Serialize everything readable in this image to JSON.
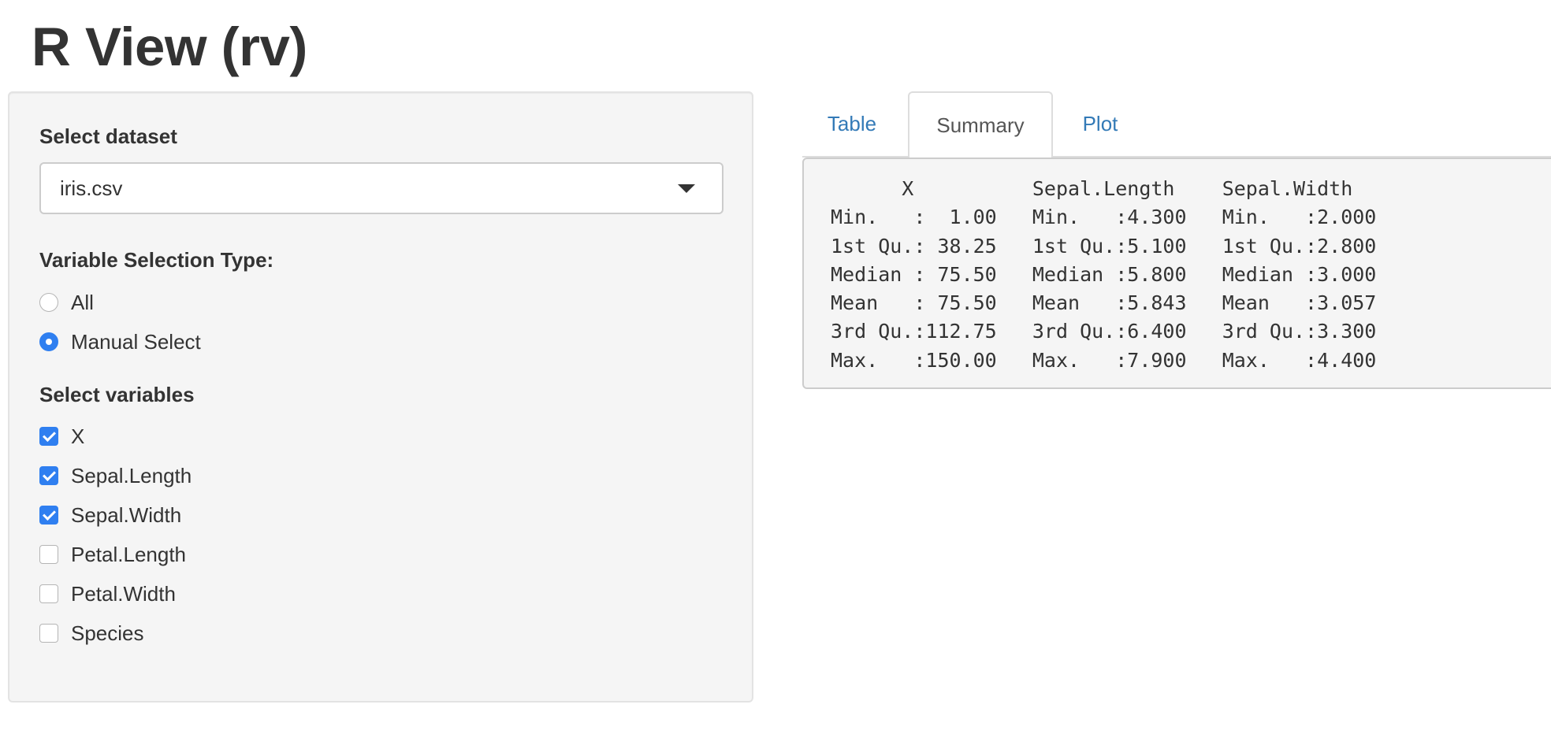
{
  "app": {
    "title": "R View (rv)"
  },
  "sidebar": {
    "dataset": {
      "label": "Select dataset",
      "selected": "iris.csv"
    },
    "selection_type": {
      "label": "Variable Selection Type:",
      "options": [
        {
          "label": "All",
          "checked": false
        },
        {
          "label": "Manual Select",
          "checked": true
        }
      ]
    },
    "variables": {
      "label": "Select variables",
      "items": [
        {
          "label": "X",
          "checked": true
        },
        {
          "label": "Sepal.Length",
          "checked": true
        },
        {
          "label": "Sepal.Width",
          "checked": true
        },
        {
          "label": "Petal.Length",
          "checked": false
        },
        {
          "label": "Petal.Width",
          "checked": false
        },
        {
          "label": "Species",
          "checked": false
        }
      ]
    }
  },
  "tabs": [
    {
      "label": "Table",
      "active": false
    },
    {
      "label": "Summary",
      "active": true
    },
    {
      "label": "Plot",
      "active": false
    }
  ],
  "summary": {
    "text": "      X          Sepal.Length    Sepal.Width   \nMin.   :  1.00   Min.   :4.300   Min.   :2.000  \n1st Qu.: 38.25   1st Qu.:5.100   1st Qu.:2.800  \nMedian : 75.50   Median :5.800   Median :3.000  \nMean   : 75.50   Mean   :5.843   Mean   :3.057  \n3rd Qu.:112.75   3rd Qu.:6.400   3rd Qu.:3.300  \nMax.   :150.00   Max.   :7.900   Max.   :4.400  "
  },
  "colors": {
    "accent": "#2f7ff0",
    "link": "#337ab7",
    "well_background": "#f5f5f5"
  }
}
